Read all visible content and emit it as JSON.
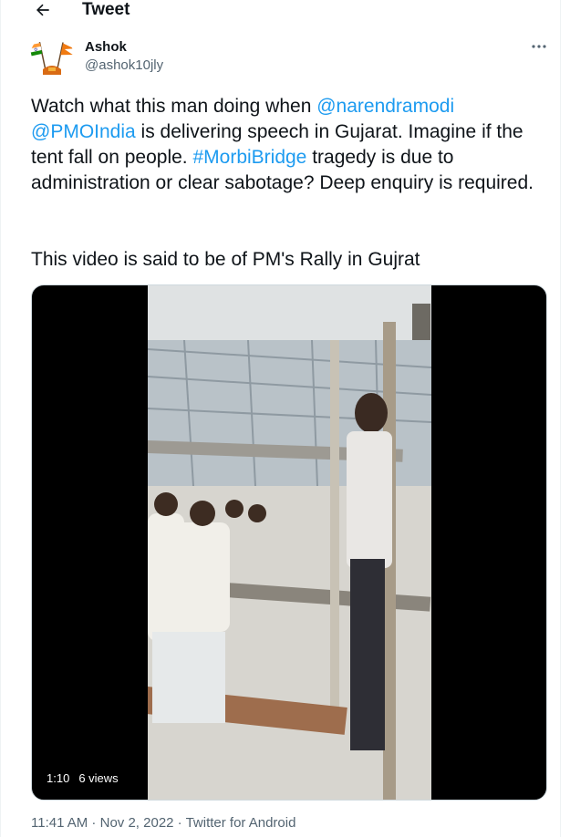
{
  "header": {
    "back_icon": "arrow-left-icon",
    "title": "Tweet"
  },
  "author": {
    "name": "Ashok",
    "handle": "@ashok10jly",
    "avatar_icon": "avatar-flags-icon"
  },
  "more_icon": "more-dots-icon",
  "tweet": {
    "segments": [
      {
        "text": "Watch what this man doing when ",
        "link": false
      },
      {
        "text": "@narendramodi",
        "link": true
      },
      {
        "text": " ",
        "link": false
      },
      {
        "text": "@PMOIndia",
        "link": true
      },
      {
        "text": " is delivering speech in Gujarat. Imagine if the tent fall on people. ",
        "link": false
      },
      {
        "text": "#MorbiBridge",
        "link": true
      },
      {
        "text": " tragedy is due to administration or clear sabotage? Deep enquiry is required.",
        "link": false
      }
    ],
    "second_paragraph": "This video is said to be of PM's Rally in Gujrat"
  },
  "media": {
    "duration": "1:10",
    "views": "6 views"
  },
  "meta": {
    "time": "11:41 AM",
    "sep1": " · ",
    "date": "Nov 2, 2022",
    "sep2": " · ",
    "source": "Twitter for Android"
  },
  "colors": {
    "link": "#1d9bf0",
    "secondary": "#536471",
    "text": "#0f1419"
  }
}
